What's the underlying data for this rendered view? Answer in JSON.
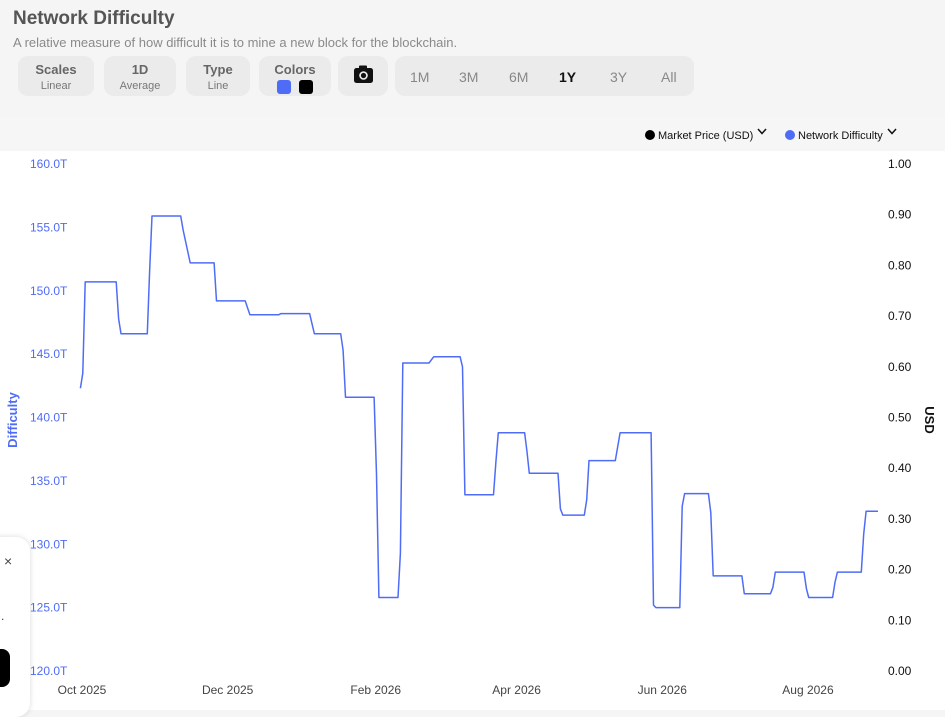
{
  "header": {
    "title": "Network Difficulty",
    "subtitle": "A relative measure of how difficult it is to mine a new block for the blockchain."
  },
  "controls": {
    "scales": {
      "label": "Scales",
      "value": "Linear"
    },
    "interval": {
      "label": "1D",
      "value": "Average"
    },
    "type": {
      "label": "Type",
      "value": "Line"
    },
    "colors": {
      "label": "Colors",
      "swatches": [
        "#4f6cf7",
        "#000000"
      ]
    },
    "camera_icon": "camera-icon",
    "ranges": [
      "1M",
      "3M",
      "6M",
      "1Y",
      "3Y",
      "All"
    ],
    "active_range": "1Y"
  },
  "legend": [
    {
      "label": "Market Price (USD)",
      "color": "#000000"
    },
    {
      "label": "Network Difficulty",
      "color": "#4f6cf7"
    }
  ],
  "popup": {
    "close": "×",
    "dot": "."
  },
  "chart_data": {
    "type": "line",
    "ylabel": "Difficulty",
    "y2label": "USD",
    "ylim": [
      120,
      160
    ],
    "y2lim": [
      0,
      1
    ],
    "y_ticks": [
      "120.0T",
      "125.0T",
      "130.0T",
      "135.0T",
      "140.0T",
      "145.0T",
      "150.0T",
      "155.0T",
      "160.0T"
    ],
    "y2_ticks": [
      "0.00",
      "0.10",
      "0.20",
      "0.30",
      "0.40",
      "0.50",
      "0.60",
      "0.70",
      "0.80",
      "0.90",
      "1.00"
    ],
    "x_ticks": [
      "Oct 2025",
      "Dec 2025",
      "Feb 2026",
      "Apr 2026",
      "Jun 2026",
      "Aug 2026"
    ],
    "grid": false,
    "legend_position": "top-right",
    "series": [
      {
        "name": "Network Difficulty",
        "color": "#4f6cf7",
        "unit": "T",
        "points": [
          [
            "2025-10-02",
            142.3
          ],
          [
            "2025-10-03",
            143.5
          ],
          [
            "2025-10-04",
            150.7
          ],
          [
            "2025-10-17",
            150.7
          ],
          [
            "2025-10-18",
            147.8
          ],
          [
            "2025-10-19",
            146.6
          ],
          [
            "2025-10-30",
            146.6
          ],
          [
            "2025-10-31",
            151.5
          ],
          [
            "2025-11-01",
            155.9
          ],
          [
            "2025-11-13",
            155.9
          ],
          [
            "2025-11-14",
            154.8
          ],
          [
            "2025-11-17",
            152.2
          ],
          [
            "2025-11-27",
            152.2
          ],
          [
            "2025-11-28",
            149.2
          ],
          [
            "2025-12-10",
            149.2
          ],
          [
            "2025-12-12",
            148.1
          ],
          [
            "2025-12-24",
            148.1
          ],
          [
            "2025-12-25",
            148.2
          ],
          [
            "2026-01-06",
            148.2
          ],
          [
            "2026-01-08",
            146.6
          ],
          [
            "2026-01-19",
            146.6
          ],
          [
            "2026-01-20",
            145.3
          ],
          [
            "2026-01-21",
            141.6
          ],
          [
            "2026-02-02",
            141.6
          ],
          [
            "2026-02-03",
            135.5
          ],
          [
            "2026-02-04",
            125.8
          ],
          [
            "2026-02-12",
            125.8
          ],
          [
            "2026-02-13",
            129.3
          ],
          [
            "2026-02-14",
            144.3
          ],
          [
            "2026-02-25",
            144.3
          ],
          [
            "2026-02-27",
            144.8
          ],
          [
            "2026-03-10",
            144.8
          ],
          [
            "2026-03-11",
            144.0
          ],
          [
            "2026-03-12",
            133.9
          ],
          [
            "2026-03-24",
            133.9
          ],
          [
            "2026-03-25",
            136.5
          ],
          [
            "2026-03-26",
            138.8
          ],
          [
            "2026-04-06",
            138.8
          ],
          [
            "2026-04-07",
            137.3
          ],
          [
            "2026-04-08",
            135.6
          ],
          [
            "2026-04-20",
            135.6
          ],
          [
            "2026-04-21",
            132.8
          ],
          [
            "2026-04-22",
            132.3
          ],
          [
            "2026-05-01",
            132.3
          ],
          [
            "2026-05-02",
            133.5
          ],
          [
            "2026-05-03",
            136.6
          ],
          [
            "2026-05-14",
            136.6
          ],
          [
            "2026-05-16",
            138.8
          ],
          [
            "2026-05-29",
            138.8
          ],
          [
            "2026-05-30",
            125.2
          ],
          [
            "2026-05-31",
            125.0
          ],
          [
            "2026-06-10",
            125.0
          ],
          [
            "2026-06-11",
            133.0
          ],
          [
            "2026-06-12",
            134.0
          ],
          [
            "2026-06-22",
            134.0
          ],
          [
            "2026-06-23",
            132.5
          ],
          [
            "2026-06-24",
            127.5
          ],
          [
            "2026-07-06",
            127.5
          ],
          [
            "2026-07-07",
            126.1
          ],
          [
            "2026-07-18",
            126.1
          ],
          [
            "2026-07-19",
            126.6
          ],
          [
            "2026-07-20",
            127.8
          ],
          [
            "2026-08-01",
            127.8
          ],
          [
            "2026-08-02",
            126.5
          ],
          [
            "2026-08-03",
            125.8
          ],
          [
            "2026-08-13",
            125.8
          ],
          [
            "2026-08-14",
            127.0
          ],
          [
            "2026-08-15",
            127.8
          ],
          [
            "2026-08-25",
            127.8
          ],
          [
            "2026-08-26",
            130.8
          ],
          [
            "2026-08-27",
            132.6
          ],
          [
            "2026-09-01",
            132.6
          ]
        ]
      }
    ]
  }
}
